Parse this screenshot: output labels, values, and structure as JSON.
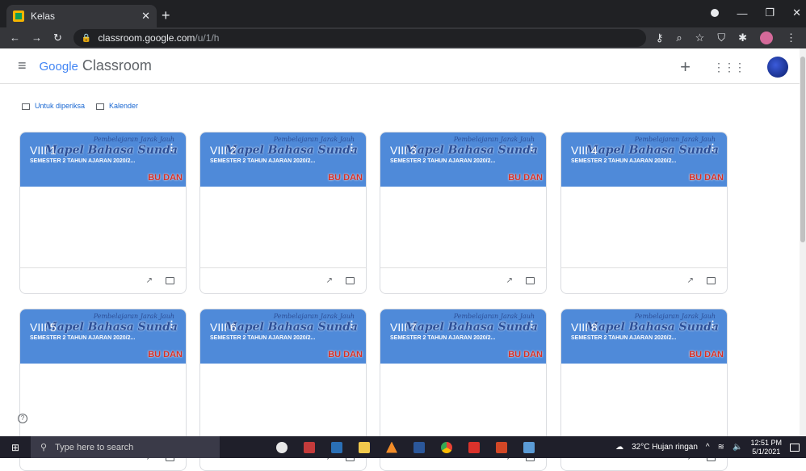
{
  "browser": {
    "tab_title": "Kelas",
    "url_host": "classroom.google.com",
    "url_path": "/u/1/h"
  },
  "app": {
    "logo_google": "Google",
    "logo_product": "Classroom"
  },
  "quick_links": [
    {
      "label": "Untuk diperiksa"
    },
    {
      "label": "Kalender"
    }
  ],
  "banner_text": {
    "line1": "Pembelajaran Jarak Jauh",
    "line2": "Mapel Bahasa Sunda",
    "line3": "BU DAN"
  },
  "classes": [
    {
      "name": "VIII 1",
      "section": "SEMESTER 2 TAHUN AJARAN 2020/2..."
    },
    {
      "name": "VIII 2",
      "section": "SEMESTER 2 TAHUN AJARAN 2020/2..."
    },
    {
      "name": "VIII 3",
      "section": "SEMESTER 2 TAHUN AJARAN 2020/2..."
    },
    {
      "name": "VIII 4",
      "section": "SEMESTER 2 TAHUN AJARAN 2020/2..."
    },
    {
      "name": "VIII 5",
      "section": "SEMESTER 2 TAHUN AJARAN 2020/2..."
    },
    {
      "name": "VIII 6",
      "section": "SEMESTER 2 TAHUN AJARAN 2020/2..."
    },
    {
      "name": "VIII 7",
      "section": "SEMESTER 2 TAHUN AJARAN 2020/2..."
    },
    {
      "name": "VIII 8",
      "section": "SEMESTER 2 TAHUN AJARAN 2020/2..."
    }
  ],
  "taskbar": {
    "search_placeholder": "Type here to search",
    "weather": "32°C  Hujan ringan",
    "time": "12:51 PM",
    "date": "5/1/2021"
  },
  "colors": {
    "banner": "#4f8ad9",
    "link": "#1967d2"
  }
}
